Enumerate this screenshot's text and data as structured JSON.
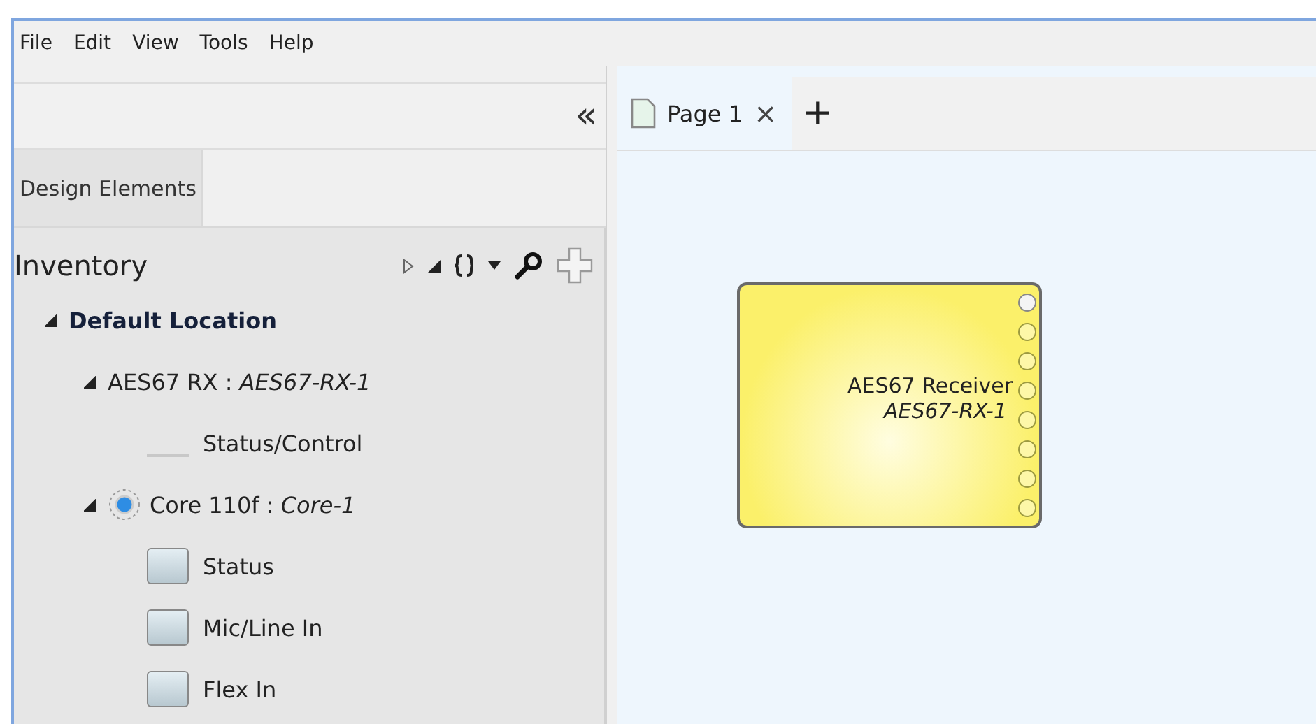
{
  "menu": [
    "File",
    "Edit",
    "View",
    "Tools",
    "Help"
  ],
  "left_panel": {
    "collapse_glyph": "«",
    "tabs": [
      {
        "label": "Design Elements",
        "selected": true
      }
    ],
    "inventory": {
      "title": "Inventory",
      "tree": [
        {
          "label": "Default Location",
          "kind": "location",
          "expanded": true,
          "children": [
            {
              "label": "AES67 RX : *AES67-RX-1*",
              "kind": "device",
              "expanded": true,
              "children": [
                {
                  "label": "Status/Control",
                  "kind": "control"
                }
              ]
            },
            {
              "label": "Core 110f : *Core-1*",
              "kind": "core",
              "expanded": true,
              "children": [
                {
                  "label": "Status",
                  "kind": "block"
                },
                {
                  "label": "Mic/Line In",
                  "kind": "block"
                },
                {
                  "label": "Flex In",
                  "kind": "block"
                }
              ]
            }
          ]
        }
      ]
    }
  },
  "page_tabs": [
    {
      "label": "Page 1",
      "selected": true,
      "close": "×"
    }
  ],
  "add_tab": "+",
  "canvas": {
    "blocks": [
      {
        "title": "AES67 Receiver",
        "name": "AES67-RX-1",
        "pins": [
          {
            "kind": "control"
          },
          {
            "kind": "audio"
          },
          {
            "kind": "audio"
          },
          {
            "kind": "audio"
          },
          {
            "kind": "audio"
          },
          {
            "kind": "audio"
          },
          {
            "kind": "audio"
          },
          {
            "kind": "audio"
          }
        ]
      }
    ]
  }
}
